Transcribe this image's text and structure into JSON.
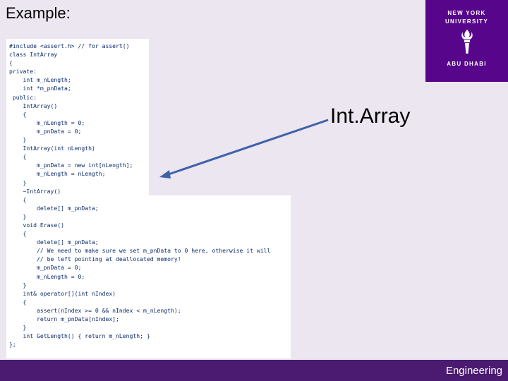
{
  "slide": {
    "title": "Example:",
    "label": "Int.Array",
    "footer": "Engineering"
  },
  "logo": {
    "line1": "NEW YORK",
    "line2": "UNIVERSITY",
    "line3": "ABU DHABI",
    "color": "#57068c"
  },
  "code_lines": [
    "#include <assert.h> // for assert()",
    "class IntArray",
    "{",
    "private:",
    "    int m_nLength;",
    "    int *m_pnData;",
    " public:",
    "    IntArray()",
    "    {",
    "        m_nLength = 0;",
    "        m_pnData = 0;",
    "    }",
    "    IntArray(int nLength)",
    "    {",
    "        m_pnData = new int[nLength];",
    "        m_nLength = nLength;",
    "    }",
    "    ~IntArray()",
    "    {",
    "        delete[] m_pnData;",
    "    }",
    "    void Erase()",
    "    {",
    "        delete[] m_pnData;",
    "        // We need to make sure we set m_pnData to 0 here, otherwise it will",
    "        // be left pointing at deallocated memory!",
    "        m_pnData = 0;",
    "        m_nLength = 0;",
    "    }",
    "    int& operator[](int nIndex)",
    "    {",
    "        assert(nIndex >= 0 && nIndex < m_nLength);",
    "        return m_pnData[nIndex];",
    "    }",
    "    int GetLength() { return m_nLength; }",
    "};"
  ],
  "colors": {
    "background": "#ece6f1",
    "footer": "#4a1b70",
    "arrow": "#3f63a8"
  }
}
